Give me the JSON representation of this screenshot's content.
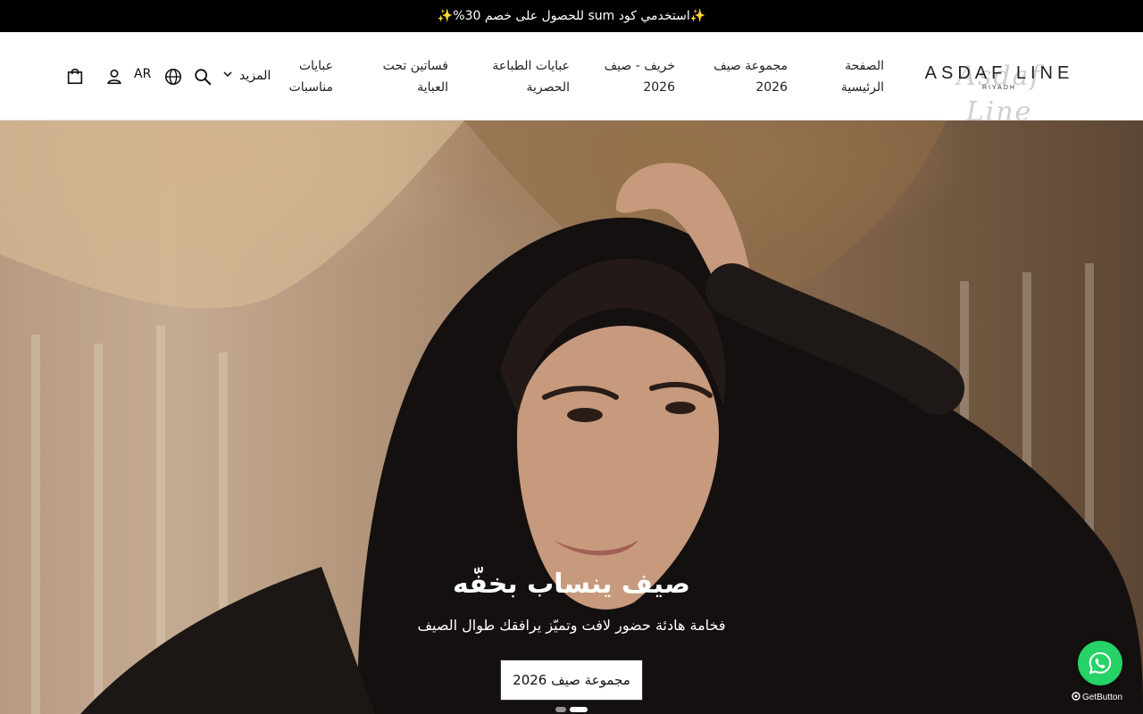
{
  "announcement": "✨استخدمي كود sum للحصول على خصم 30%✨",
  "brand": {
    "script": "Asdaf Line",
    "name": "ASDAF LINE",
    "city": "RIYADH"
  },
  "nav": {
    "items": [
      {
        "label": "الصفحة الرئيسية"
      },
      {
        "label": "مجموعة صيف 2026"
      },
      {
        "label": "خريف - صيف 2026"
      },
      {
        "label": "عبايات الطباعة الحصرية"
      },
      {
        "label": "فساتين تحت العباية"
      },
      {
        "label": "عبايات مناسبات"
      }
    ],
    "more_label": "المزيد",
    "language": "AR"
  },
  "icons": {
    "search": "search-icon",
    "globe": "globe-icon",
    "account": "user-icon",
    "cart": "shopping-bag-icon",
    "whatsapp": "whatsapp-icon"
  },
  "hero": {
    "title": "صيف ينساب بخفّه",
    "subtitle": "فخامة هادئة حضور لافت وتميّز يرافقك طوال الصيف",
    "cta": "مجموعة صيف 2026",
    "slides": 2,
    "active_slide": 2
  },
  "widget": {
    "label": "GetButton"
  },
  "colors": {
    "announce_bg": "#000000",
    "whatsapp": "#25d366"
  }
}
